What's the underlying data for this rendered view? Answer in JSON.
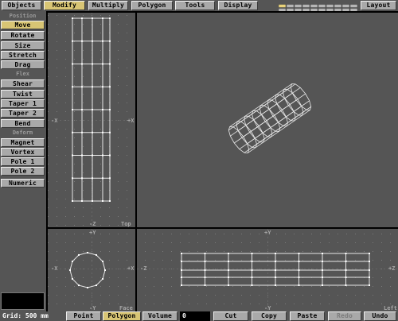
{
  "menu": {
    "tabs": [
      "Objects",
      "Modify",
      "Multiply",
      "Polygon",
      "Tools",
      "Display"
    ],
    "active_tab": "Modify",
    "layout": "Layout"
  },
  "sidebar": {
    "position_title": "Position",
    "position": [
      "Move",
      "Rotate",
      "Size",
      "Stretch",
      "Drag"
    ],
    "flex_title": "Flex",
    "flex": [
      "Shear",
      "Twist",
      "Taper 1",
      "Taper 2",
      "Bend"
    ],
    "deform_title": "Deform",
    "deform": [
      "Magnet",
      "Vortex",
      "Pole 1",
      "Pole 2"
    ],
    "numeric": "Numeric"
  },
  "viewports": {
    "top": {
      "name": "Top",
      "axis_left": "-X",
      "axis_right": "+X",
      "axis_bottom": "-Z"
    },
    "face": {
      "name": "Face",
      "axis_top": "+Y",
      "axis_left": "-X",
      "axis_right": "+X",
      "axis_bottom": "-Y"
    },
    "left": {
      "name": "Left",
      "axis_top": "+Y",
      "axis_left": "-Z",
      "axis_right": "+Z",
      "axis_bottom": "-Y"
    }
  },
  "bottom": {
    "grid": "Grid: 500 mm",
    "point": "Point",
    "polygon": "Polygon",
    "volume": "Volume",
    "count": "0",
    "cut": "Cut",
    "copy": "Copy",
    "paste": "Paste",
    "redo": "Redo",
    "undo": "Undo"
  },
  "colors": {
    "active": "#d8c574",
    "button": "#a9a9a9",
    "viewport": "#555555",
    "wire": "#e8e8e8"
  }
}
